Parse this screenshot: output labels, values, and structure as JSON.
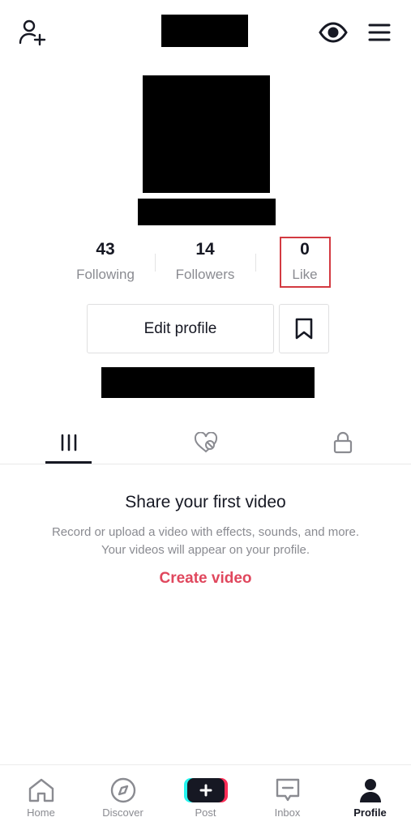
{
  "stats": {
    "following": {
      "count": "43",
      "label": "Following"
    },
    "followers": {
      "count": "14",
      "label": "Followers"
    },
    "likes": {
      "count": "0",
      "label": "Like"
    }
  },
  "profile_actions": {
    "edit_label": "Edit profile"
  },
  "tabs": [
    {
      "name": "videos",
      "icon": "grid-icon",
      "active": true
    },
    {
      "name": "liked",
      "icon": "hidden-heart-icon",
      "active": false
    },
    {
      "name": "private",
      "icon": "lock-icon",
      "active": false
    }
  ],
  "empty_state": {
    "title": "Share your first video",
    "description": "Record or upload a video with effects, sounds, and more. Your videos will appear on your profile.",
    "cta": "Create video"
  },
  "bottom_nav": {
    "home": "Home",
    "discover": "Discover",
    "post": "Post",
    "inbox": "Inbox",
    "profile": "Profile"
  },
  "colors": {
    "accent": "#e0475d",
    "highlight_border": "#d33a41",
    "muted_text": "#8a8b91",
    "primary_text": "#161823"
  }
}
